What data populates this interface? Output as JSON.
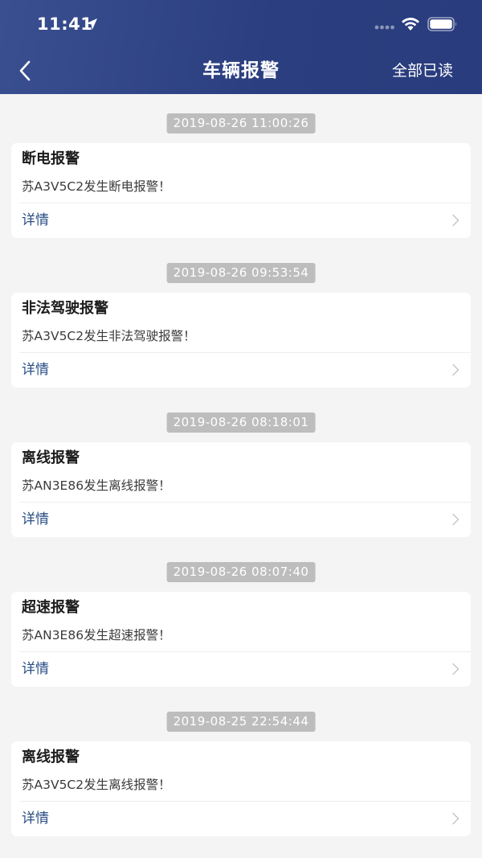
{
  "status_bar": {
    "time": "11:41"
  },
  "nav": {
    "title": "车辆报警",
    "mark_all_read": "全部已读"
  },
  "alarms": [
    {
      "time": "2019-08-26 11:00:26",
      "title": "断电报警",
      "message": "苏A3V5C2发生断电报警！",
      "detail": "详情"
    },
    {
      "time": "2019-08-26 09:53:54",
      "title": "非法驾驶报警",
      "message": "苏A3V5C2发生非法驾驶报警！",
      "detail": "详情"
    },
    {
      "time": "2019-08-26 08:18:01",
      "title": "离线报警",
      "message": "苏AN3E86发生离线报警！",
      "detail": "详情"
    },
    {
      "time": "2019-08-26 08:07:40",
      "title": "超速报警",
      "message": "苏AN3E86发生超速报警！",
      "detail": "详情"
    },
    {
      "time": "2019-08-25 22:54:44",
      "title": "离线报警",
      "message": "苏A3V5C2发生离线报警！",
      "detail": "详情"
    }
  ],
  "colors": {
    "header_bg": "#2b3f80",
    "link": "#2a4e86",
    "badge_bg": "#bdbdbd",
    "page_bg": "#f4f4f4"
  },
  "icons": {
    "back": "chevron-left-icon",
    "location": "location-arrow-icon",
    "signal": "signal-dots-icon",
    "wifi": "wifi-icon",
    "battery": "battery-icon",
    "chevron": "chevron-right-icon"
  }
}
